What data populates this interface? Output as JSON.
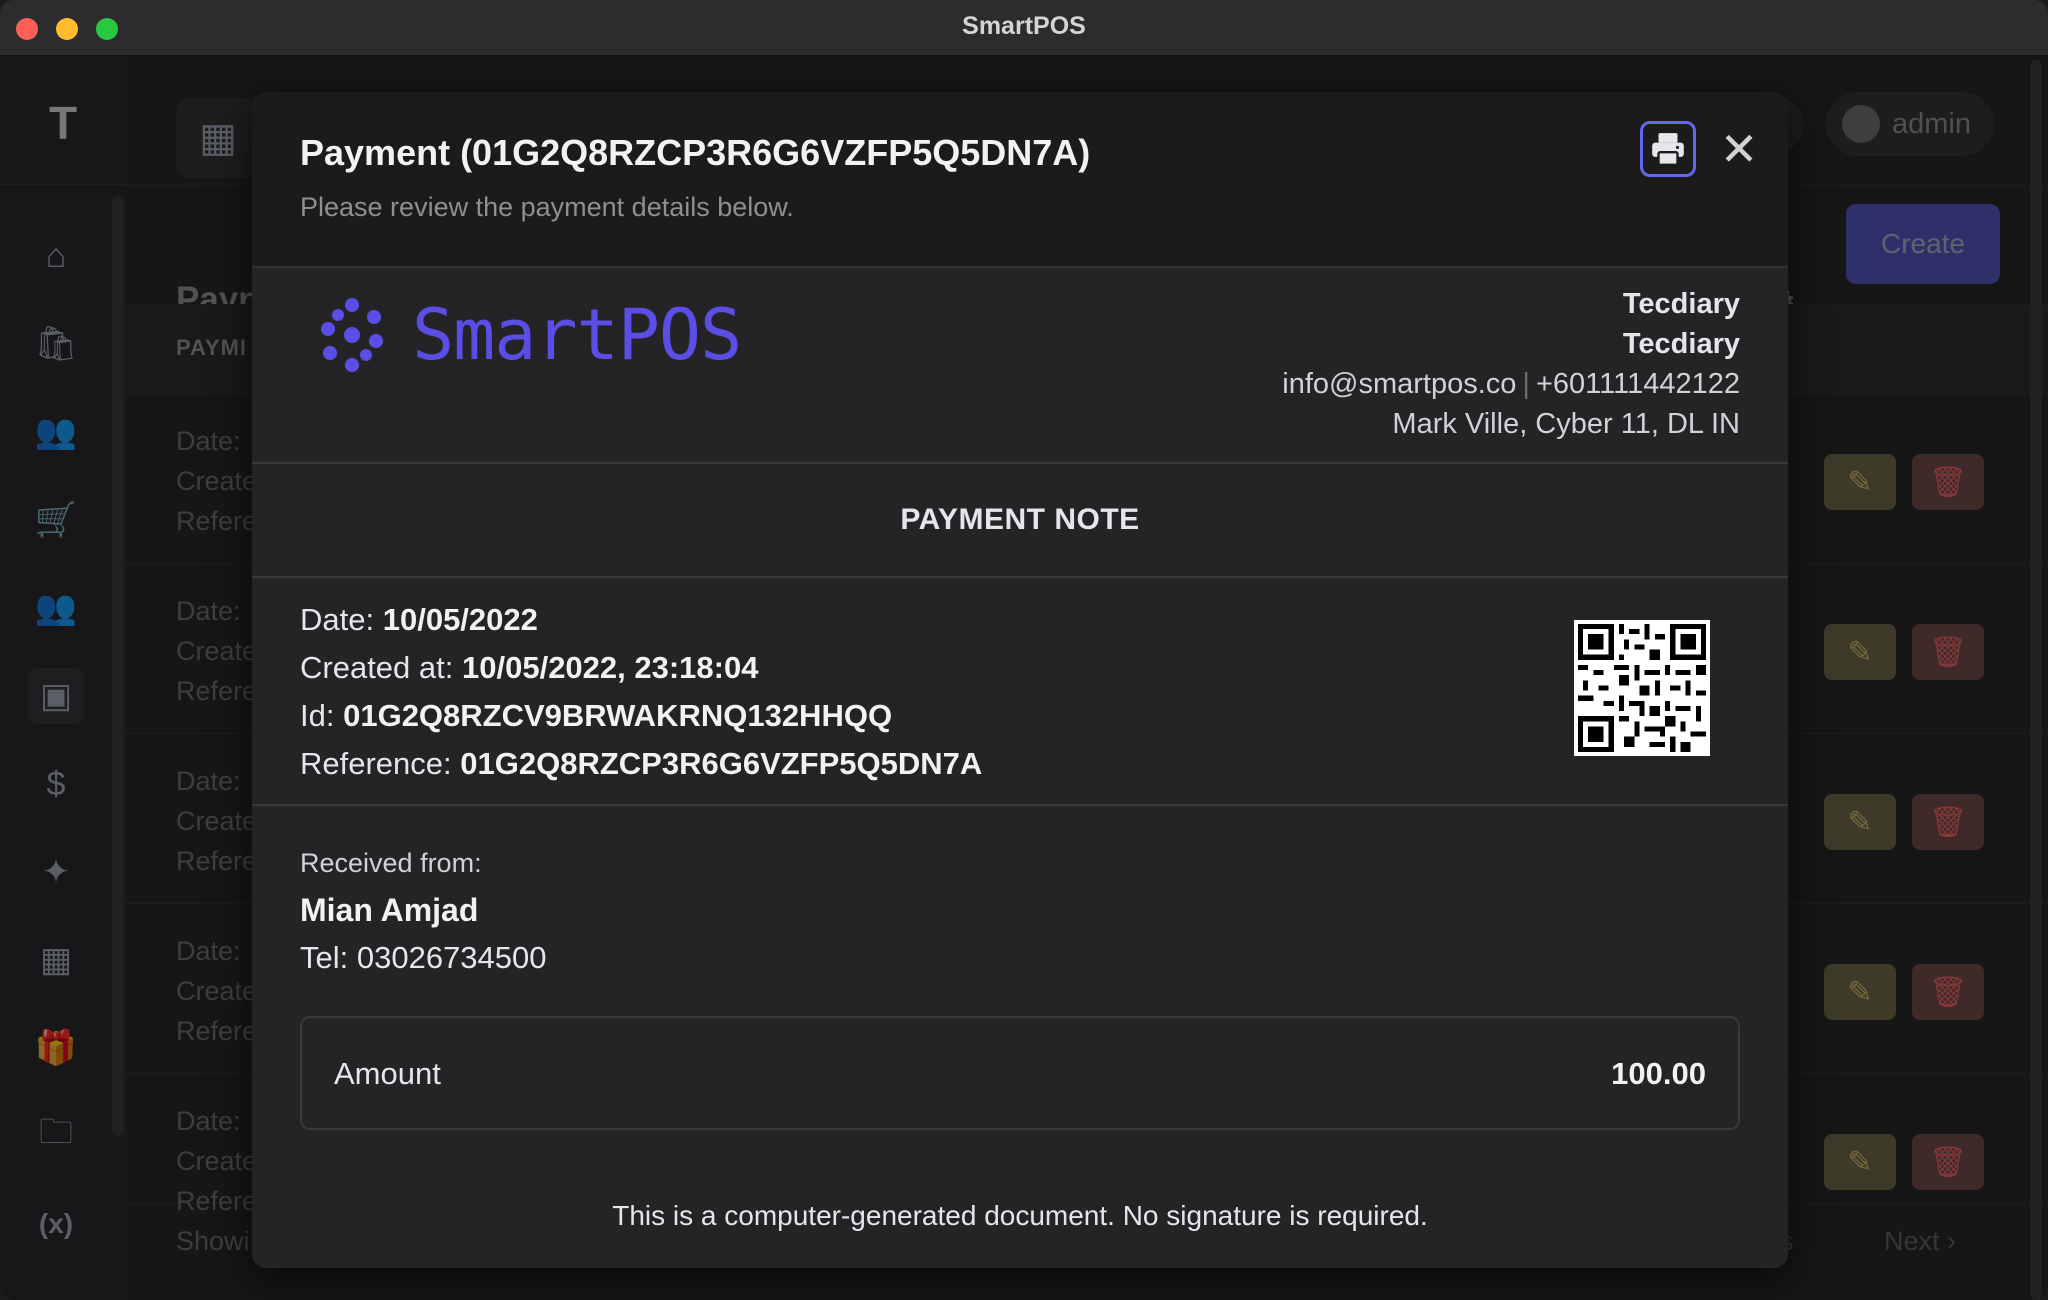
{
  "window": {
    "title": "SmartPOS"
  },
  "sidebar": {
    "brand": "T",
    "items": [
      {
        "icon": "home-icon",
        "glyph": "⌂"
      },
      {
        "icon": "shopping-bag-icon",
        "glyph": "🛍"
      },
      {
        "icon": "users-icon",
        "glyph": "👥"
      },
      {
        "icon": "cart-icon",
        "glyph": "🛒"
      },
      {
        "icon": "customers-icon",
        "glyph": "👥"
      },
      {
        "icon": "payments-icon",
        "glyph": "▣"
      },
      {
        "icon": "dollar-icon",
        "glyph": "$"
      },
      {
        "icon": "sparkles-icon",
        "glyph": "✦"
      },
      {
        "icon": "qrcode-icon",
        "glyph": "▦"
      },
      {
        "icon": "gift-icon",
        "glyph": "🎁"
      },
      {
        "icon": "folder-icon",
        "glyph": "🗀"
      },
      {
        "icon": "variable-icon",
        "glyph": "(x)"
      }
    ]
  },
  "topbar": {
    "user": "admin"
  },
  "page": {
    "title": "Payn",
    "create_label": "Create",
    "table_header": "PAYMI",
    "row_labels": [
      "Date:",
      "Create",
      "Refere"
    ],
    "pager_left": "Showi",
    "pager_prev": "ous",
    "pager_next": "Next ›"
  },
  "modal": {
    "title": "Payment (01G2Q8RZCP3R6G6VZFP5Q5DN7A)",
    "subtitle": "Please review the payment details below.",
    "company": {
      "logo_text": "SmartPOS",
      "name1": "Tecdiary",
      "name2": "Tecdiary",
      "email": "info@smartpos.co",
      "phone": "+601111442122",
      "address": "Mark Ville, Cyber 11, DL IN"
    },
    "note_title": "PAYMENT NOTE",
    "details": {
      "date_label": "Date:",
      "date_value": "10/05/2022",
      "created_label": "Created at:",
      "created_value": "10/05/2022, 23:18:04",
      "id_label": "Id:",
      "id_value": "01G2Q8RZCV9BRWAKRNQ132HHQQ",
      "ref_label": "Reference:",
      "ref_value": "01G2Q8RZCP3R6G6VZFP5Q5DN7A"
    },
    "received": {
      "label": "Received from:",
      "name": "Mian Amjad",
      "tel": "Tel: 03026734500"
    },
    "amount": {
      "label": "Amount",
      "value": "100.00"
    },
    "footer": "This is a computer-generated document. No signature is required.",
    "colors": {
      "accent": "#6366f1",
      "logo": "#5b4ee6"
    }
  }
}
